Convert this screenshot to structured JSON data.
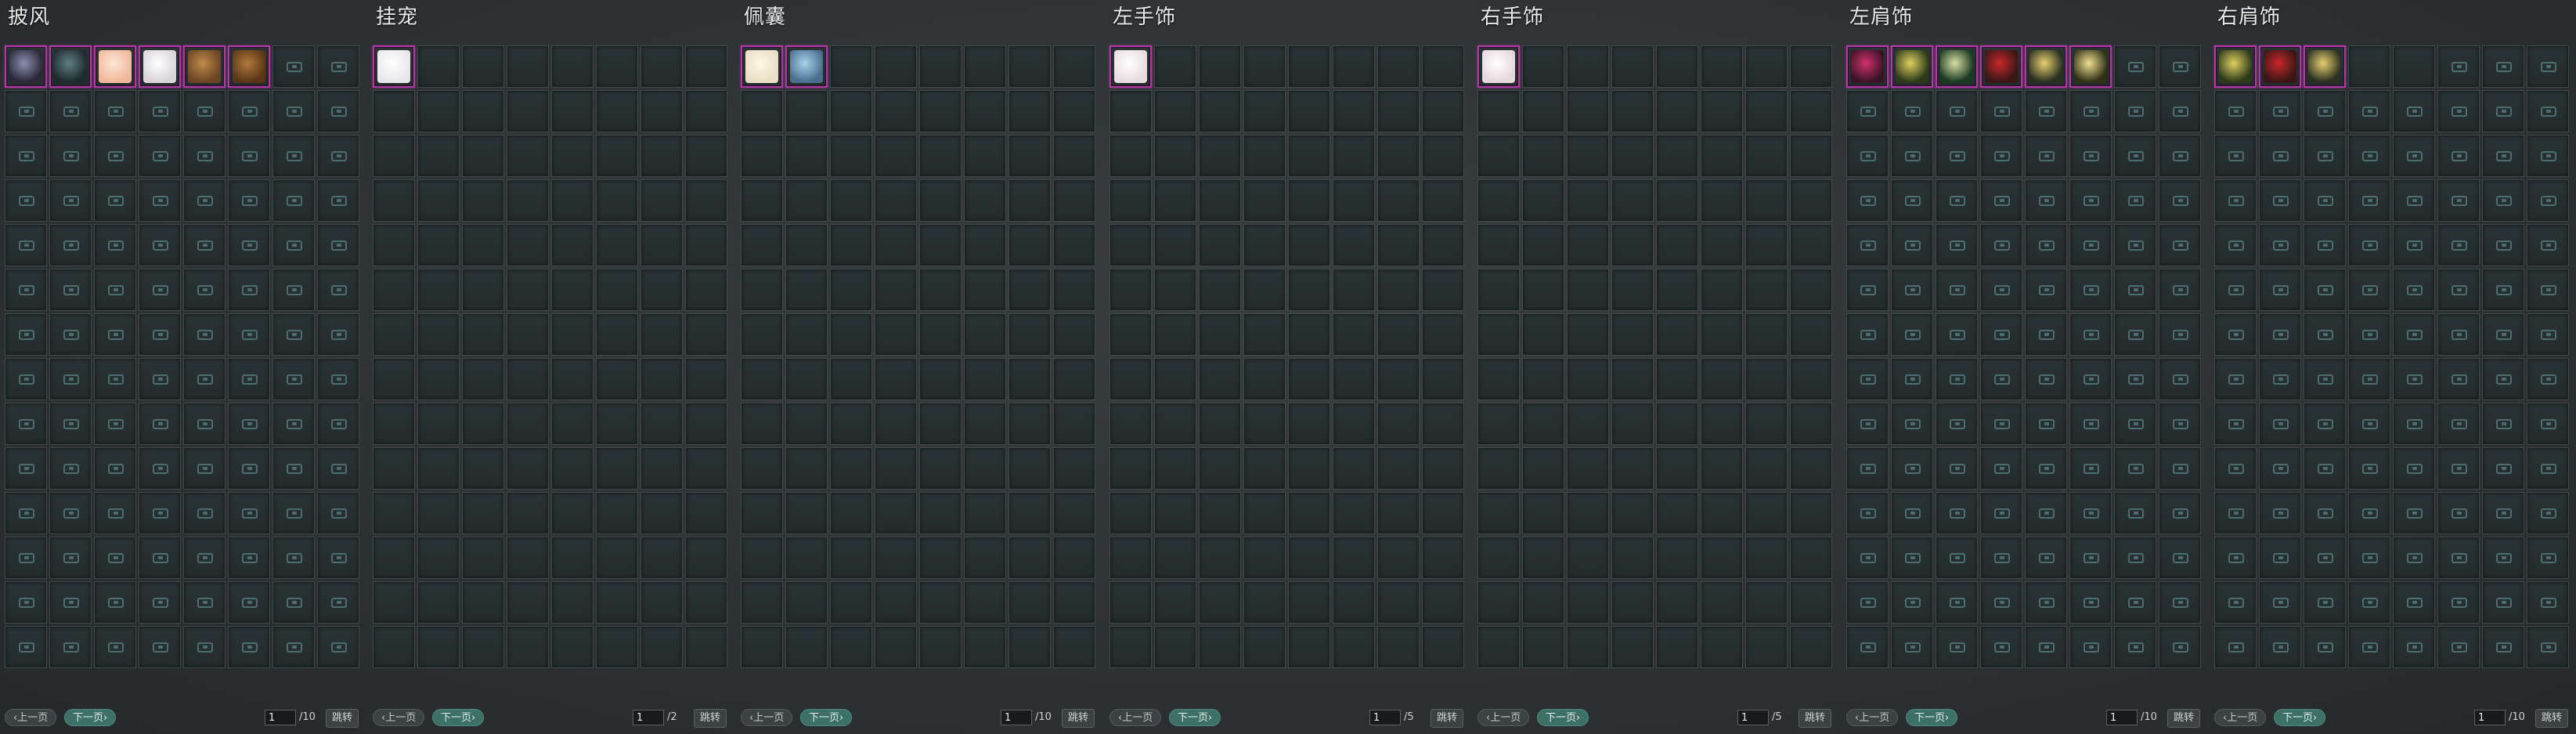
{
  "panels": [
    {
      "title": "披风",
      "page": "1",
      "total": "/10",
      "items": [
        {
          "icon": "cloak-icon",
          "colors": [
            "#2c2838",
            "#8a8fb0"
          ]
        },
        {
          "icon": "cloak-icon",
          "colors": [
            "#1e2a2e",
            "#5f7f83"
          ]
        },
        {
          "icon": "cloak-icon",
          "colors": [
            "#f0b89a",
            "#fde6d8"
          ]
        },
        {
          "icon": "cloak-icon",
          "colors": [
            "#d9d4da",
            "#ffffff"
          ]
        },
        {
          "icon": "cloak-icon",
          "colors": [
            "#6b4524",
            "#c08a4a"
          ]
        },
        {
          "icon": "cloak-icon",
          "colors": [
            "#5a3618",
            "#b17a3a"
          ]
        }
      ],
      "unlocked": 6,
      "locked_first_row": true
    },
    {
      "title": "挂宠",
      "page": "1",
      "total": "/2",
      "items": [
        {
          "icon": "pet-icon",
          "colors": [
            "#e8e6ea",
            "#ffffff"
          ]
        }
      ],
      "unlocked": 1,
      "locked_first_row": false
    },
    {
      "title": "佩囊",
      "page": "1",
      "total": "/10",
      "items": [
        {
          "icon": "pouch-icon",
          "colors": [
            "#e9dfc7",
            "#fff7e3"
          ]
        },
        {
          "icon": "pouch-icon",
          "colors": [
            "#4a6f8e",
            "#a9d2ea"
          ]
        }
      ],
      "unlocked": 2,
      "locked_first_row": false
    },
    {
      "title": "左手饰",
      "page": "1",
      "total": "/5",
      "items": [
        {
          "icon": "hand-ornament-icon",
          "colors": [
            "#e8dce0",
            "#ffffff"
          ]
        }
      ],
      "unlocked": 1,
      "locked_first_row": false
    },
    {
      "title": "右手饰",
      "page": "1",
      "total": "/5",
      "items": [
        {
          "icon": "hand-ornament-icon",
          "colors": [
            "#e5d7db",
            "#ffffff"
          ]
        }
      ],
      "unlocked": 1,
      "locked_first_row": false
    },
    {
      "title": "左肩饰",
      "page": "1",
      "total": "/10",
      "items": [
        {
          "icon": "shoulder-ornament-icon",
          "colors": [
            "#3a1426",
            "#d0306b"
          ]
        },
        {
          "icon": "shoulder-ornament-icon",
          "colors": [
            "#2c3a1a",
            "#e0d060"
          ]
        },
        {
          "icon": "shoulder-ornament-icon",
          "colors": [
            "#1a3a24",
            "#d8e0a0"
          ]
        },
        {
          "icon": "shoulder-ornament-icon",
          "colors": [
            "#3a1616",
            "#c8282a"
          ]
        },
        {
          "icon": "shoulder-ornament-icon",
          "colors": [
            "#2a3020",
            "#e8d070"
          ]
        },
        {
          "icon": "shoulder-ornament-icon",
          "colors": [
            "#303018",
            "#f0e090"
          ]
        }
      ],
      "unlocked": 6,
      "locked_first_row": true
    },
    {
      "title": "右肩饰",
      "page": "1",
      "total": "/10",
      "items": [
        {
          "icon": "shoulder-ornament-icon",
          "colors": [
            "#2c3a1a",
            "#e0d060"
          ]
        },
        {
          "icon": "shoulder-ornament-icon",
          "colors": [
            "#3a1616",
            "#c8282a"
          ]
        },
        {
          "icon": "shoulder-ornament-icon",
          "colors": [
            "#2a3020",
            "#e8d070"
          ]
        }
      ],
      "unlocked": 3,
      "locked_first_row": true
    }
  ],
  "pager": {
    "prev_label": "‹上一页",
    "next_label": "下一页›",
    "jump_label": "跳转"
  }
}
